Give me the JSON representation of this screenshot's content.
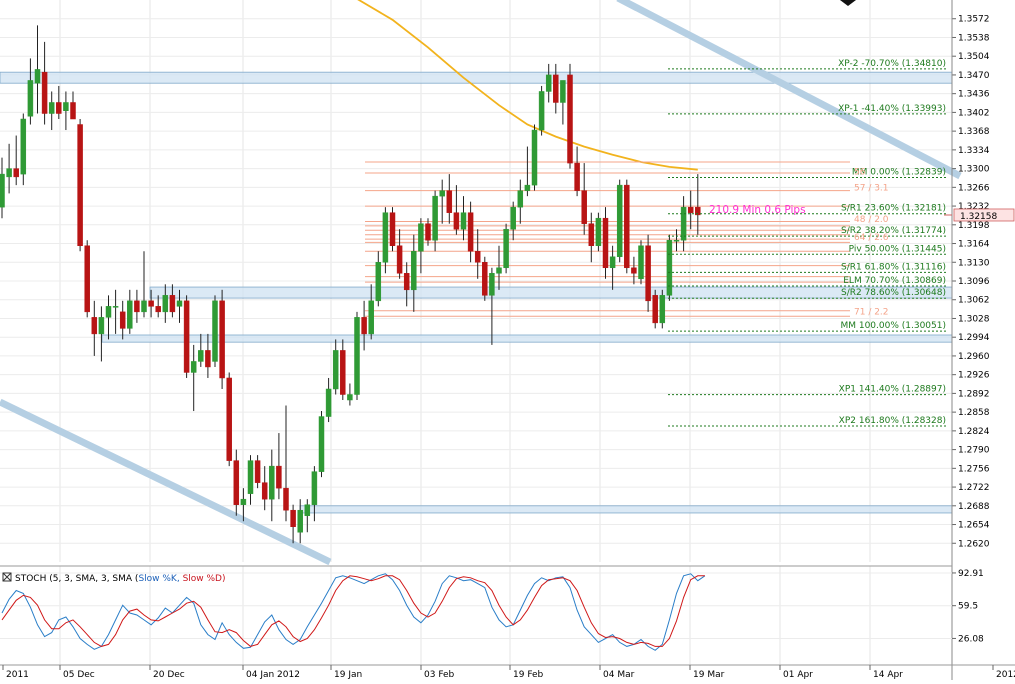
{
  "chart_data": {
    "type": "candlestick",
    "price_axis": {
      "ylim": [
        1.2586,
        1.3606
      ],
      "tick_labels": [
        "1.3572",
        "1.3538",
        "1.3504",
        "1.3470",
        "1.3436",
        "1.3402",
        "1.3368",
        "1.3334",
        "1.3300",
        "1.3266",
        "1.3232",
        "1.3198",
        "1.3164",
        "1.3130",
        "1.3096",
        "1.3062",
        "1.3028",
        "1.2994",
        "1.2960",
        "1.2926",
        "1.2892",
        "1.2858",
        "1.2824",
        "1.2790",
        "1.2756",
        "1.2722",
        "1.2688",
        "1.2654",
        "1.2620"
      ],
      "current_price": "1.32158"
    },
    "date_labels": [
      "2011",
      "05 Dec",
      "20 Dec",
      "04 Jan 2012",
      "19 Jan",
      "03 Feb",
      "19 Feb",
      "04 Mar",
      "19 Mar",
      "01 Apr",
      "14 Apr",
      "2012"
    ],
    "candles": [
      {
        "o": 1.323,
        "h": 1.332,
        "l": 1.321,
        "c": 1.329
      },
      {
        "o": 1.3285,
        "h": 1.3345,
        "l": 1.3255,
        "c": 1.33
      },
      {
        "o": 1.33,
        "h": 1.336,
        "l": 1.327,
        "c": 1.3285
      },
      {
        "o": 1.329,
        "h": 1.34,
        "l": 1.327,
        "c": 1.339
      },
      {
        "o": 1.3395,
        "h": 1.35,
        "l": 1.338,
        "c": 1.346
      },
      {
        "o": 1.3455,
        "h": 1.356,
        "l": 1.34,
        "c": 1.348
      },
      {
        "o": 1.3475,
        "h": 1.353,
        "l": 1.338,
        "c": 1.34
      },
      {
        "o": 1.34,
        "h": 1.344,
        "l": 1.337,
        "c": 1.342
      },
      {
        "o": 1.342,
        "h": 1.345,
        "l": 1.339,
        "c": 1.34
      },
      {
        "o": 1.3405,
        "h": 1.344,
        "l": 1.337,
        "c": 1.342
      },
      {
        "o": 1.342,
        "h": 1.344,
        "l": 1.339,
        "c": 1.339
      },
      {
        "o": 1.338,
        "h": 1.339,
        "l": 1.315,
        "c": 1.316
      },
      {
        "o": 1.316,
        "h": 1.317,
        "l": 1.303,
        "c": 1.304
      },
      {
        "o": 1.303,
        "h": 1.306,
        "l": 1.296,
        "c": 1.3
      },
      {
        "o": 1.3,
        "h": 1.305,
        "l": 1.295,
        "c": 1.303
      },
      {
        "o": 1.303,
        "h": 1.307,
        "l": 1.299,
        "c": 1.305
      },
      {
        "o": 1.305,
        "h": 1.308,
        "l": 1.3,
        "c": 1.305
      },
      {
        "o": 1.304,
        "h": 1.306,
        "l": 1.299,
        "c": 1.301
      },
      {
        "o": 1.301,
        "h": 1.308,
        "l": 1.3,
        "c": 1.306
      },
      {
        "o": 1.306,
        "h": 1.308,
        "l": 1.302,
        "c": 1.304
      },
      {
        "o": 1.304,
        "h": 1.315,
        "l": 1.303,
        "c": 1.306
      },
      {
        "o": 1.306,
        "h": 1.308,
        "l": 1.303,
        "c": 1.305
      },
      {
        "o": 1.305,
        "h": 1.307,
        "l": 1.303,
        "c": 1.304
      },
      {
        "o": 1.304,
        "h": 1.309,
        "l": 1.302,
        "c": 1.307
      },
      {
        "o": 1.307,
        "h": 1.309,
        "l": 1.303,
        "c": 1.304
      },
      {
        "o": 1.305,
        "h": 1.308,
        "l": 1.302,
        "c": 1.306
      },
      {
        "o": 1.306,
        "h": 1.307,
        "l": 1.292,
        "c": 1.293
      },
      {
        "o": 1.293,
        "h": 1.298,
        "l": 1.286,
        "c": 1.295
      },
      {
        "o": 1.295,
        "h": 1.3,
        "l": 1.294,
        "c": 1.297
      },
      {
        "o": 1.297,
        "h": 1.3,
        "l": 1.292,
        "c": 1.294
      },
      {
        "o": 1.295,
        "h": 1.307,
        "l": 1.294,
        "c": 1.306
      },
      {
        "o": 1.306,
        "h": 1.308,
        "l": 1.29,
        "c": 1.292
      },
      {
        "o": 1.292,
        "h": 1.293,
        "l": 1.276,
        "c": 1.277
      },
      {
        "o": 1.277,
        "h": 1.279,
        "l": 1.267,
        "c": 1.269
      },
      {
        "o": 1.269,
        "h": 1.272,
        "l": 1.266,
        "c": 1.27
      },
      {
        "o": 1.271,
        "h": 1.278,
        "l": 1.269,
        "c": 1.277
      },
      {
        "o": 1.277,
        "h": 1.278,
        "l": 1.272,
        "c": 1.273
      },
      {
        "o": 1.273,
        "h": 1.276,
        "l": 1.268,
        "c": 1.27
      },
      {
        "o": 1.27,
        "h": 1.279,
        "l": 1.266,
        "c": 1.276
      },
      {
        "o": 1.276,
        "h": 1.282,
        "l": 1.27,
        "c": 1.272
      },
      {
        "o": 1.272,
        "h": 1.287,
        "l": 1.266,
        "c": 1.268
      },
      {
        "o": 1.268,
        "h": 1.269,
        "l": 1.262,
        "c": 1.265
      },
      {
        "o": 1.264,
        "h": 1.27,
        "l": 1.262,
        "c": 1.268
      },
      {
        "o": 1.267,
        "h": 1.27,
        "l": 1.264,
        "c": 1.269
      },
      {
        "o": 1.269,
        "h": 1.276,
        "l": 1.266,
        "c": 1.275
      },
      {
        "o": 1.275,
        "h": 1.286,
        "l": 1.274,
        "c": 1.285
      },
      {
        "o": 1.285,
        "h": 1.292,
        "l": 1.284,
        "c": 1.29
      },
      {
        "o": 1.29,
        "h": 1.299,
        "l": 1.289,
        "c": 1.297
      },
      {
        "o": 1.297,
        "h": 1.299,
        "l": 1.288,
        "c": 1.289
      },
      {
        "o": 1.288,
        "h": 1.291,
        "l": 1.287,
        "c": 1.289
      },
      {
        "o": 1.289,
        "h": 1.304,
        "l": 1.288,
        "c": 1.303
      },
      {
        "o": 1.303,
        "h": 1.306,
        "l": 1.297,
        "c": 1.3
      },
      {
        "o": 1.3,
        "h": 1.309,
        "l": 1.299,
        "c": 1.306
      },
      {
        "o": 1.306,
        "h": 1.315,
        "l": 1.305,
        "c": 1.313
      },
      {
        "o": 1.313,
        "h": 1.323,
        "l": 1.311,
        "c": 1.322
      },
      {
        "o": 1.322,
        "h": 1.323,
        "l": 1.315,
        "c": 1.316
      },
      {
        "o": 1.316,
        "h": 1.319,
        "l": 1.31,
        "c": 1.311
      },
      {
        "o": 1.311,
        "h": 1.313,
        "l": 1.305,
        "c": 1.308
      },
      {
        "o": 1.308,
        "h": 1.318,
        "l": 1.304,
        "c": 1.315
      },
      {
        "o": 1.315,
        "h": 1.321,
        "l": 1.311,
        "c": 1.32
      },
      {
        "o": 1.32,
        "h": 1.321,
        "l": 1.316,
        "c": 1.317
      },
      {
        "o": 1.317,
        "h": 1.326,
        "l": 1.315,
        "c": 1.325
      },
      {
        "o": 1.325,
        "h": 1.328,
        "l": 1.32,
        "c": 1.326
      },
      {
        "o": 1.326,
        "h": 1.329,
        "l": 1.32,
        "c": 1.322
      },
      {
        "o": 1.322,
        "h": 1.327,
        "l": 1.318,
        "c": 1.319
      },
      {
        "o": 1.319,
        "h": 1.325,
        "l": 1.317,
        "c": 1.322
      },
      {
        "o": 1.322,
        "h": 1.324,
        "l": 1.313,
        "c": 1.315
      },
      {
        "o": 1.315,
        "h": 1.319,
        "l": 1.31,
        "c": 1.313
      },
      {
        "o": 1.313,
        "h": 1.314,
        "l": 1.306,
        "c": 1.307
      },
      {
        "o": 1.307,
        "h": 1.312,
        "l": 1.298,
        "c": 1.311
      },
      {
        "o": 1.311,
        "h": 1.316,
        "l": 1.308,
        "c": 1.312
      },
      {
        "o": 1.312,
        "h": 1.32,
        "l": 1.311,
        "c": 1.319
      },
      {
        "o": 1.319,
        "h": 1.324,
        "l": 1.317,
        "c": 1.323
      },
      {
        "o": 1.323,
        "h": 1.328,
        "l": 1.32,
        "c": 1.326
      },
      {
        "o": 1.326,
        "h": 1.334,
        "l": 1.325,
        "c": 1.327
      },
      {
        "o": 1.327,
        "h": 1.338,
        "l": 1.326,
        "c": 1.337
      },
      {
        "o": 1.337,
        "h": 1.345,
        "l": 1.336,
        "c": 1.344
      },
      {
        "o": 1.344,
        "h": 1.349,
        "l": 1.342,
        "c": 1.347
      },
      {
        "o": 1.347,
        "h": 1.349,
        "l": 1.34,
        "c": 1.342
      },
      {
        "o": 1.342,
        "h": 1.346,
        "l": 1.338,
        "c": 1.346
      },
      {
        "o": 1.347,
        "h": 1.349,
        "l": 1.33,
        "c": 1.331
      },
      {
        "o": 1.331,
        "h": 1.334,
        "l": 1.325,
        "c": 1.326
      },
      {
        "o": 1.326,
        "h": 1.331,
        "l": 1.318,
        "c": 1.32
      },
      {
        "o": 1.32,
        "h": 1.322,
        "l": 1.313,
        "c": 1.316
      },
      {
        "o": 1.316,
        "h": 1.322,
        "l": 1.315,
        "c": 1.321
      },
      {
        "o": 1.321,
        "h": 1.323,
        "l": 1.31,
        "c": 1.312
      },
      {
        "o": 1.312,
        "h": 1.316,
        "l": 1.308,
        "c": 1.314
      },
      {
        "o": 1.314,
        "h": 1.328,
        "l": 1.313,
        "c": 1.327
      },
      {
        "o": 1.327,
        "h": 1.328,
        "l": 1.311,
        "c": 1.312
      },
      {
        "o": 1.312,
        "h": 1.314,
        "l": 1.309,
        "c": 1.311
      },
      {
        "o": 1.31,
        "h": 1.317,
        "l": 1.309,
        "c": 1.316
      },
      {
        "o": 1.316,
        "h": 1.318,
        "l": 1.304,
        "c": 1.306
      },
      {
        "o": 1.307,
        "h": 1.308,
        "l": 1.301,
        "c": 1.302
      },
      {
        "o": 1.302,
        "h": 1.308,
        "l": 1.301,
        "c": 1.307
      },
      {
        "o": 1.307,
        "h": 1.318,
        "l": 1.306,
        "c": 1.317
      },
      {
        "o": 1.317,
        "h": 1.319,
        "l": 1.315,
        "c": 1.317
      },
      {
        "o": 1.317,
        "h": 1.325,
        "l": 1.315,
        "c": 1.323
      },
      {
        "o": 1.323,
        "h": 1.326,
        "l": 1.319,
        "c": 1.322
      },
      {
        "o": 1.323,
        "h": 1.329,
        "l": 1.318,
        "c": 1.3216
      }
    ],
    "ma_points": [
      {
        "bar": 49.5,
        "v": 1.3612
      },
      {
        "bar": 55,
        "v": 1.357
      },
      {
        "bar": 60,
        "v": 1.352
      },
      {
        "bar": 65,
        "v": 1.3465
      },
      {
        "bar": 70,
        "v": 1.3415
      },
      {
        "bar": 74,
        "v": 1.338
      },
      {
        "bar": 78,
        "v": 1.3358
      },
      {
        "bar": 82,
        "v": 1.334
      },
      {
        "bar": 86,
        "v": 1.3325
      },
      {
        "bar": 90,
        "v": 1.3312
      },
      {
        "bar": 94,
        "v": 1.3303
      },
      {
        "bar": 98,
        "v": 1.3298
      }
    ],
    "fib_levels": [
      {
        "label": "XP-2 -70.70% (1.34810)",
        "value": 1.3481,
        "color": "#1e7a1e"
      },
      {
        "label": "XP-1 -41.40% (1.33993)",
        "value": 1.33993,
        "color": "#1e7a1e"
      },
      {
        "label": "MM 0.00% (1.32839)",
        "value": 1.32839,
        "color": "#1e7a1e"
      },
      {
        "label": "S/R1 23.60% (1.32181)",
        "value": 1.32181,
        "color": "#1e7a1e"
      },
      {
        "label": "S/R2 38.20% (1.31774)",
        "value": 1.31774,
        "color": "#1e7a1e"
      },
      {
        "label": "Piv 50.00% (1.31445)",
        "value": 1.31445,
        "color": "#1e7a1e"
      },
      {
        "label": "S/R1 61.80% (1.31116)",
        "value": 1.31116,
        "color": "#1e7a1e"
      },
      {
        "label": "ELM 70.70% (1.30869)",
        "value": 1.30869,
        "color": "#1e7a1e"
      },
      {
        "label": "S/R2 78.60% (1.30648)",
        "value": 1.30648,
        "color": "#1e7a1e"
      },
      {
        "label": "MM 100.00% (1.30051)",
        "value": 1.30051,
        "color": "#1e7a1e"
      },
      {
        "label": "XP1 141.40% (1.28897)",
        "value": 1.28897,
        "color": "#1e7a1e"
      },
      {
        "label": "XP2 161.80% (1.28328)",
        "value": 1.28328,
        "color": "#1e7a1e"
      }
    ],
    "orange_labels": [
      {
        "text": "56",
        "value": 1.32839
      },
      {
        "text": "57 / 3.1",
        "value": 1.3255
      },
      {
        "text": "48 / 2.0",
        "value": 1.3198
      },
      {
        "text": "64 / 2.6",
        "value": 1.3165
      },
      {
        "text": "71 / 2.2",
        "value": 1.303
      }
    ],
    "annotation": "210.9 Min 0.6 Pips",
    "annotation_value": 1.3218,
    "zones": [
      {
        "from": 1.3455,
        "to": 1.3475
      },
      {
        "from": 1.3065,
        "to": 1.3085
      },
      {
        "from": 1.2985,
        "to": 1.2998
      },
      {
        "from": 1.2675,
        "to": 1.2688
      }
    ],
    "stoch": {
      "label_prefix": "STOCH (5, 3, SMA, 3, SMA)",
      "k_label": "Slow %K,",
      "d_label": "Slow %D)",
      "ticks": [
        "92.91",
        "59.5",
        "26.08"
      ],
      "ylim": [
        0,
        100
      ],
      "k": [
        52,
        66,
        75,
        72,
        58,
        40,
        28,
        32,
        45,
        48,
        38,
        26,
        20,
        15,
        18,
        30,
        45,
        60,
        52,
        50,
        45,
        40,
        47,
        57,
        52,
        60,
        68,
        62,
        40,
        30,
        25,
        42,
        30,
        22,
        16,
        17,
        30,
        43,
        50,
        35,
        25,
        20,
        25,
        38,
        50,
        62,
        75,
        88,
        90,
        88,
        85,
        82,
        86,
        90,
        92,
        86,
        75,
        60,
        48,
        42,
        50,
        64,
        82,
        90,
        88,
        85,
        86,
        82,
        78,
        58,
        45,
        38,
        40,
        55,
        70,
        82,
        88,
        85,
        88,
        89,
        78,
        55,
        38,
        30,
        22,
        26,
        30,
        22,
        18,
        20,
        25,
        18,
        14,
        20,
        45,
        72,
        90,
        92,
        85,
        90
      ],
      "d": [
        45,
        55,
        65,
        70,
        68,
        60,
        45,
        36,
        36,
        42,
        45,
        38,
        30,
        22,
        18,
        20,
        30,
        45,
        54,
        56,
        50,
        45,
        44,
        48,
        52,
        56,
        62,
        64,
        58,
        45,
        33,
        32,
        35,
        32,
        24,
        18,
        20,
        30,
        40,
        44,
        38,
        28,
        23,
        26,
        35,
        47,
        60,
        75,
        85,
        90,
        89,
        87,
        85,
        87,
        90,
        90,
        86,
        75,
        62,
        52,
        48,
        52,
        64,
        78,
        87,
        89,
        88,
        85,
        83,
        75,
        60,
        48,
        40,
        45,
        55,
        68,
        80,
        86,
        87,
        88,
        85,
        75,
        58,
        42,
        31,
        27,
        28,
        26,
        22,
        20,
        22,
        21,
        18,
        18,
        26,
        44,
        68,
        86,
        90,
        90
      ]
    }
  }
}
